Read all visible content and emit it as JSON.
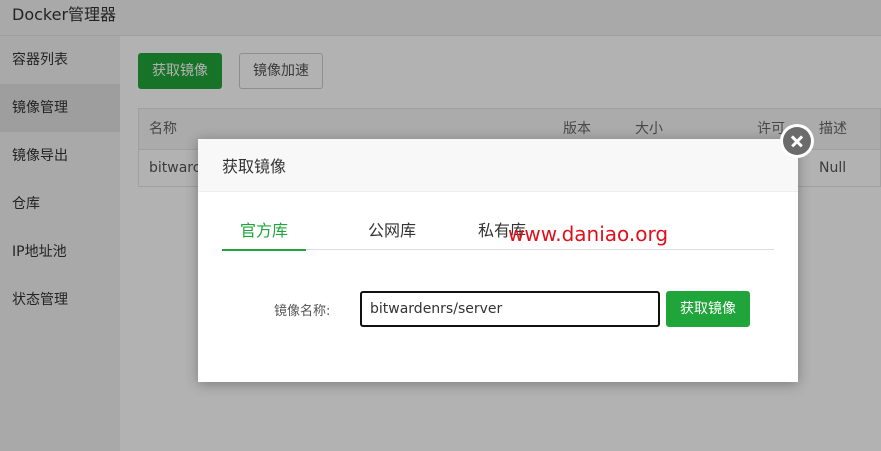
{
  "app": {
    "title": "Docker管理器"
  },
  "sidebar": {
    "items": [
      {
        "label": "容器列表"
      },
      {
        "label": "镜像管理"
      },
      {
        "label": "镜像导出"
      },
      {
        "label": "仓库"
      },
      {
        "label": "IP地址池"
      },
      {
        "label": "状态管理"
      }
    ]
  },
  "toolbar": {
    "get_image_label": "获取镜像",
    "accelerate_label": "镜像加速"
  },
  "table": {
    "headers": {
      "name": "名称",
      "version": "版本",
      "size": "大小",
      "license": "许可",
      "desc": "描述"
    },
    "rows": [
      {
        "name": "bitwarc",
        "desc": "Null"
      }
    ]
  },
  "modal": {
    "title": "获取镜像",
    "tabs": [
      {
        "label": "官方库"
      },
      {
        "label": "公网库"
      },
      {
        "label": "私有库"
      }
    ],
    "field_label": "镜像名称:",
    "field_value": "bitwardenrs/server",
    "submit_label": "获取镜像"
  },
  "watermark": "www.daniao.org",
  "colors": {
    "accent": "#20a53a",
    "watermark": "#e0101a"
  }
}
